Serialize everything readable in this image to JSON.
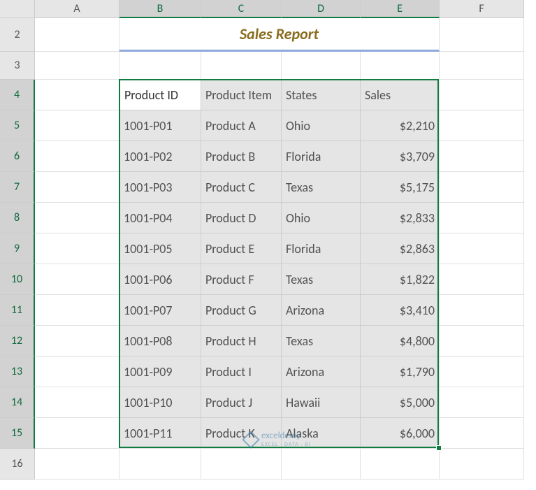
{
  "columns": [
    {
      "label": "A",
      "width": 121
    },
    {
      "label": "B",
      "width": 117
    },
    {
      "label": "C",
      "width": 115
    },
    {
      "label": "D",
      "width": 113
    },
    {
      "label": "E",
      "width": 113
    },
    {
      "label": "F",
      "width": 121
    }
  ],
  "rows": [
    {
      "label": "2",
      "height": 48
    },
    {
      "label": "3",
      "height": 40
    },
    {
      "label": "4",
      "height": 44
    },
    {
      "label": "5",
      "height": 44
    },
    {
      "label": "6",
      "height": 44
    },
    {
      "label": "7",
      "height": 44
    },
    {
      "label": "8",
      "height": 44
    },
    {
      "label": "9",
      "height": 44
    },
    {
      "label": "10",
      "height": 44
    },
    {
      "label": "11",
      "height": 44
    },
    {
      "label": "12",
      "height": 44
    },
    {
      "label": "13",
      "height": 44
    },
    {
      "label": "14",
      "height": 44
    },
    {
      "label": "15",
      "height": 44
    },
    {
      "label": "16",
      "height": 44
    }
  ],
  "title": "Sales Report",
  "headers": {
    "b": "Product ID",
    "c": "Product Item",
    "d": "States",
    "e": "Sales"
  },
  "data": [
    {
      "id": "1001-P01",
      "item": "Product A",
      "state": "Ohio",
      "sales": "$2,210"
    },
    {
      "id": "1001-P02",
      "item": "Product B",
      "state": "Florida",
      "sales": "$3,709"
    },
    {
      "id": "1001-P03",
      "item": "Product C",
      "state": "Texas",
      "sales": "$5,175"
    },
    {
      "id": "1001-P04",
      "item": "Product D",
      "state": "Ohio",
      "sales": "$2,833"
    },
    {
      "id": "1001-P05",
      "item": "Product E",
      "state": "Florida",
      "sales": "$2,863"
    },
    {
      "id": "1001-P06",
      "item": "Product F",
      "state": "Texas",
      "sales": "$1,822"
    },
    {
      "id": "1001-P07",
      "item": "Product G",
      "state": "Arizona",
      "sales": "$3,410"
    },
    {
      "id": "1001-P08",
      "item": "Product H",
      "state": "Texas",
      "sales": "$4,800"
    },
    {
      "id": "1001-P09",
      "item": "Product I",
      "state": "Arizona",
      "sales": "$1,790"
    },
    {
      "id": "1001-P10",
      "item": "Product J",
      "state": "Hawaii",
      "sales": "$5,000"
    },
    {
      "id": "1001-P11",
      "item": "Product K",
      "state": "Alaska",
      "sales": "$6,000"
    }
  ],
  "watermark": {
    "brand": "exceldemy",
    "tagline": "EXCEL · DATA · BI"
  },
  "chart_data": {
    "type": "table",
    "title": "Sales Report",
    "columns": [
      "Product ID",
      "Product Item",
      "States",
      "Sales"
    ],
    "rows": [
      [
        "1001-P01",
        "Product A",
        "Ohio",
        2210
      ],
      [
        "1001-P02",
        "Product B",
        "Florida",
        3709
      ],
      [
        "1001-P03",
        "Product C",
        "Texas",
        5175
      ],
      [
        "1001-P04",
        "Product D",
        "Ohio",
        2833
      ],
      [
        "1001-P05",
        "Product E",
        "Florida",
        2863
      ],
      [
        "1001-P06",
        "Product F",
        "Texas",
        1822
      ],
      [
        "1001-P07",
        "Product G",
        "Arizona",
        3410
      ],
      [
        "1001-P08",
        "Product H",
        "Texas",
        4800
      ],
      [
        "1001-P09",
        "Product I",
        "Arizona",
        1790
      ],
      [
        "1001-P10",
        "Product J",
        "Hawaii",
        5000
      ],
      [
        "1001-P11",
        "Product K",
        "Alaska",
        6000
      ]
    ]
  }
}
